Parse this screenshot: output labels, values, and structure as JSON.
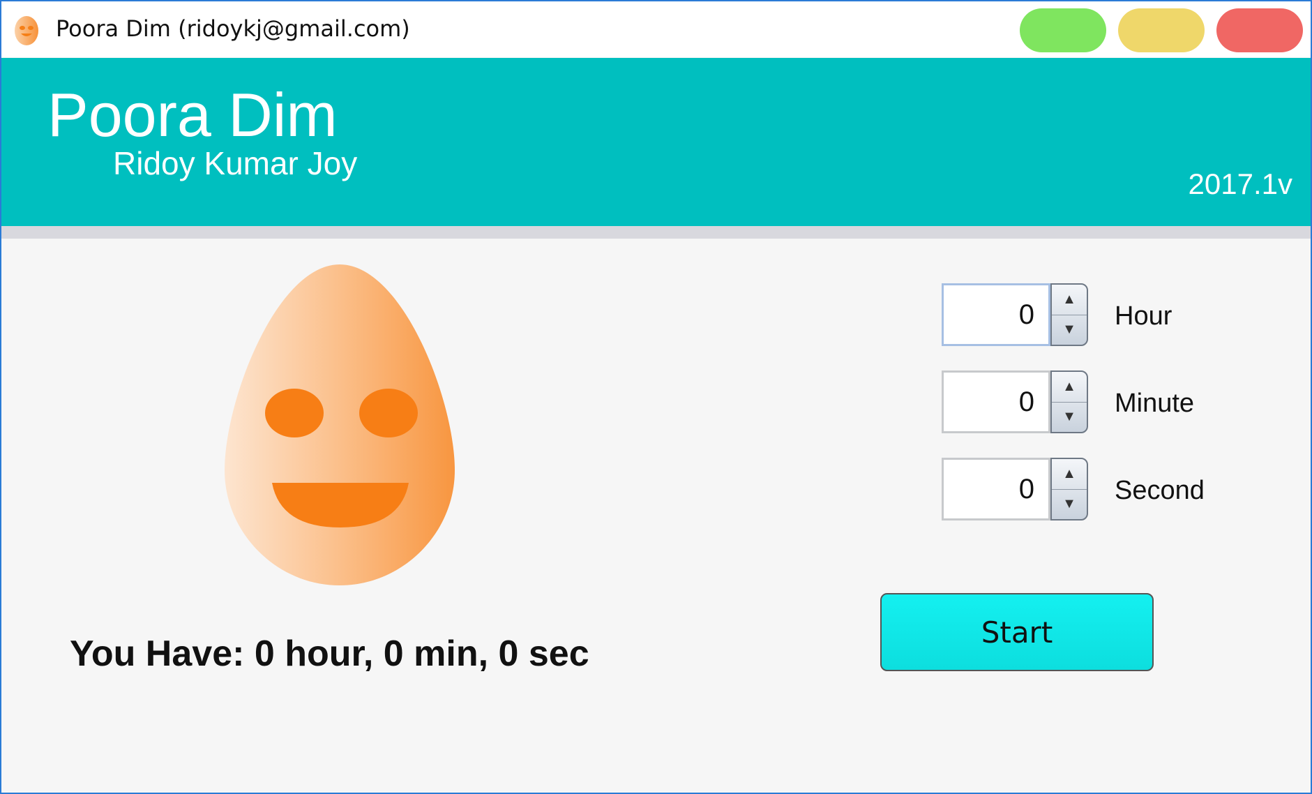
{
  "window": {
    "title": "Poora Dim (ridoykj@gmail.com)",
    "buttons": [
      "maximize-button",
      "minimize-button",
      "close-button"
    ],
    "colors": {
      "maximize": "#7fe55f",
      "minimize": "#efd76a",
      "close": "#f06764",
      "border": "#2b7bd6"
    }
  },
  "header": {
    "title": "Poora Dim",
    "subtitle": "Ridoy Kumar Joy",
    "version": "2017.1v",
    "background": "#00bfbf"
  },
  "timer": {
    "hour": {
      "value": "0",
      "label": "Hour"
    },
    "minute": {
      "value": "0",
      "label": "Minute"
    },
    "second": {
      "value": "0",
      "label": "Second"
    }
  },
  "status_text": "You Have: 0 hour, 0 min, 0 sec",
  "start_label": "Start",
  "icons": {
    "app": "egg-icon",
    "mascot": "smiling-egg-icon",
    "spin_up": "triangle-up-icon",
    "spin_down": "triangle-down-icon"
  }
}
